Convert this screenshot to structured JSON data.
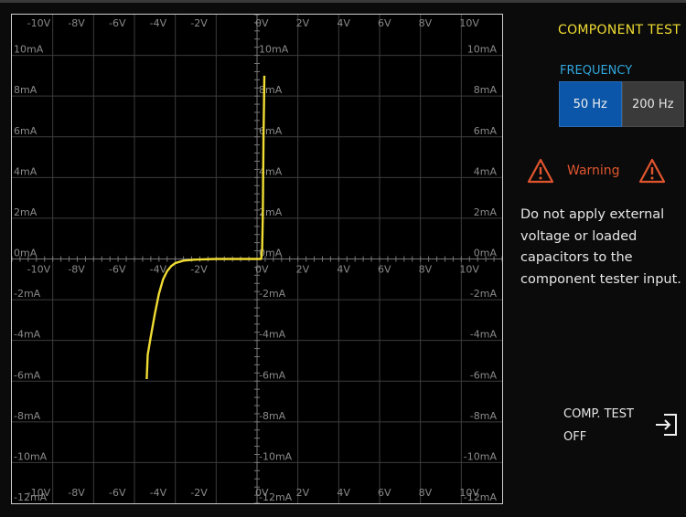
{
  "scope": {
    "x_tick_labels": [
      "-10V",
      "-8V",
      "-6V",
      "-4V",
      "-2V",
      "0V",
      "2V",
      "4V",
      "6V",
      "8V",
      "10V"
    ],
    "y_tick_labels": [
      "10mA",
      "8mA",
      "6mA",
      "4mA",
      "2mA",
      "0mA",
      "-2mA",
      "-4mA",
      "-6mA",
      "-8mA",
      "-10mA",
      "-12mA"
    ],
    "trace_color": "#f0dc33",
    "grid_color": "#3c3c3c",
    "trace": [
      [
        -5.4,
        -5.9
      ],
      [
        -5.35,
        -4.7
      ],
      [
        -5.2,
        -3.8
      ],
      [
        -5.0,
        -2.7
      ],
      [
        -4.8,
        -1.7
      ],
      [
        -4.6,
        -1.0
      ],
      [
        -4.4,
        -0.6
      ],
      [
        -4.2,
        -0.35
      ],
      [
        -4.0,
        -0.2
      ],
      [
        -3.6,
        -0.08
      ],
      [
        -3.0,
        -0.03
      ],
      [
        -2.0,
        0.0
      ],
      [
        -1.0,
        0.0
      ],
      [
        0.0,
        0.0
      ],
      [
        0.2,
        0.0
      ],
      [
        0.25,
        0.5
      ],
      [
        0.28,
        2.0
      ],
      [
        0.3,
        4.0
      ],
      [
        0.32,
        6.0
      ],
      [
        0.34,
        7.5
      ],
      [
        0.35,
        8.2
      ],
      [
        0.36,
        9.0
      ]
    ]
  },
  "panel": {
    "title": "COMPONENT TEST",
    "frequency_label": "FREQUENCY",
    "freq_options": [
      "50 Hz",
      "200 Hz"
    ],
    "freq_selected": "50 Hz",
    "warning_title": "Warning",
    "warning_text": "Do not apply external voltage or loaded capacitors to the component tester input.",
    "comp_test_line1": "COMP. TEST",
    "comp_test_line2": "OFF",
    "colors": {
      "accent_yellow": "#f0dc33",
      "accent_blue": "#31a6dd",
      "warning": "#e0552e"
    }
  }
}
